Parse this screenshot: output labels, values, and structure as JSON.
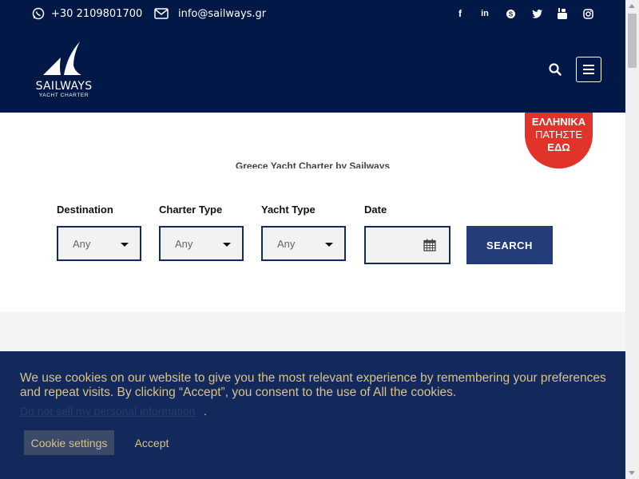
{
  "topbar": {
    "phone": "+30 2109801700",
    "email": "info@sailways.gr",
    "social_icons": [
      "facebook-icon",
      "linkedin-icon",
      "skype-icon",
      "twitter-icon",
      "youtube-icon",
      "instagram-icon"
    ]
  },
  "logo": {
    "name": "SAILWAYS",
    "tagline": "YACHT CHARTER"
  },
  "badge": {
    "line1": "ΕΛΛΗΝΙΚΑ",
    "line2": "ΠΑΤΗΣΤΕ",
    "line3": "ΕΔΩ"
  },
  "search_form": {
    "subtitle": "Greece Yacht Charter by Sailways",
    "destination_label": "Destination",
    "destination_value": "Any",
    "charter_type_label": "Charter Type",
    "charter_type_value": "Any",
    "yacht_type_label": "Yacht Type",
    "yacht_type_value": "Any",
    "date_label": "Date",
    "search_label": "SEARCH"
  },
  "cookie": {
    "text": "We use cookies on our website to give you the most relevant experience by remembering your preferences and repeat visits. By clicking “Accept”, you consent to the use of All the cookies.",
    "link": "Do not sell my personal information",
    "dot": ".",
    "settings_label": "Cookie settings",
    "accept_label": "Accept"
  },
  "colors": {
    "header_bg": "#021846",
    "badge_red": "#e2332b",
    "search_btn": "#243c78",
    "cookie_bg": "#14295b",
    "cookie_text": "#d8c288"
  }
}
